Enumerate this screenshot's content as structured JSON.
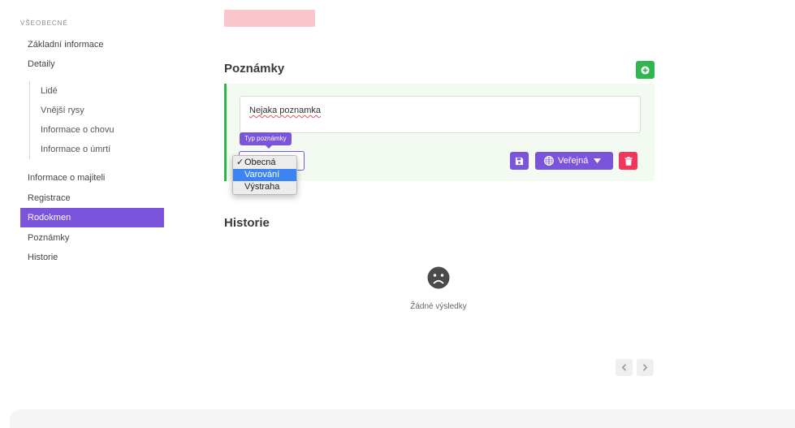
{
  "sidebar": {
    "section": "VŠEOBECNÉ",
    "items": [
      {
        "label": "Základní informace"
      },
      {
        "label": "Detaily"
      },
      {
        "label": "Informace o majiteli"
      },
      {
        "label": "Registrace"
      },
      {
        "label": "Rodokmen"
      },
      {
        "label": "Poznámky"
      },
      {
        "label": "Historie"
      }
    ],
    "sub_items": [
      {
        "label": "Lidé"
      },
      {
        "label": "Vnější rysy"
      },
      {
        "label": "Informace o chovu"
      },
      {
        "label": "Informace o úmrtí"
      }
    ],
    "active_item": "Rodokmen"
  },
  "notes": {
    "title": "Poznámky",
    "note_text": "Nejaka poznamka",
    "type_tooltip": "Typ poznámky",
    "type_options": [
      {
        "label": "Obecná",
        "checked": "✓"
      },
      {
        "label": "Varování",
        "checked": ""
      },
      {
        "label": "Výstraha",
        "checked": ""
      }
    ],
    "highlighted_option": "Varování",
    "visibility_label": "Veřejná",
    "icons": {
      "add": "plus-circle-icon",
      "save": "floppy-disk-icon",
      "visibility": "globe-icon",
      "caret": "caret-down-icon",
      "delete": "trash-icon"
    }
  },
  "history": {
    "title": "Historie",
    "empty_text": "Žádné výsledky",
    "icons": {
      "empty": "sad-face-icon",
      "prev": "chevron-left-icon",
      "next": "chevron-right-icon"
    }
  },
  "colors": {
    "accent": "#7a55dc",
    "success": "#2fb64e",
    "danger": "#f2355a",
    "highlight": "#3a84f4"
  }
}
